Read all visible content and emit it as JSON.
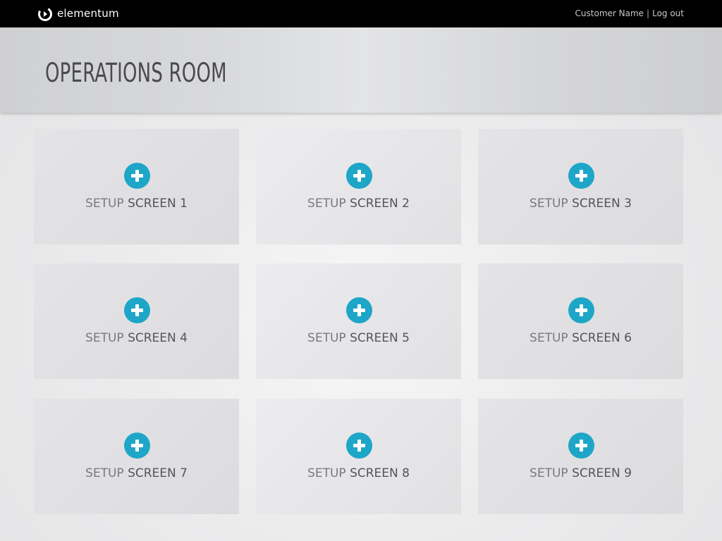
{
  "brand": {
    "name": "elementum",
    "logo_icon": "elementum-logo-mark"
  },
  "user_nav": {
    "customer_name": "Customer Name",
    "separator": "|",
    "logout_label": "Log out"
  },
  "page": {
    "title": "OPERATIONS ROOM"
  },
  "tiles": [
    {
      "prefix": "SETUP",
      "label": "SCREEN 1",
      "icon": "plus-circle-icon"
    },
    {
      "prefix": "SETUP",
      "label": "SCREEN 2",
      "icon": "plus-circle-icon"
    },
    {
      "prefix": "SETUP",
      "label": "SCREEN 3",
      "icon": "plus-circle-icon"
    },
    {
      "prefix": "SETUP",
      "label": "SCREEN 4",
      "icon": "plus-circle-icon"
    },
    {
      "prefix": "SETUP",
      "label": "SCREEN 5",
      "icon": "plus-circle-icon"
    },
    {
      "prefix": "SETUP",
      "label": "SCREEN 6",
      "icon": "plus-circle-icon"
    },
    {
      "prefix": "SETUP",
      "label": "SCREEN 7",
      "icon": "plus-circle-icon"
    },
    {
      "prefix": "SETUP",
      "label": "SCREEN 8",
      "icon": "plus-circle-icon"
    },
    {
      "prefix": "SETUP",
      "label": "SCREEN 9",
      "icon": "plus-circle-icon"
    }
  ],
  "colors": {
    "accent": "#1ea6c8",
    "topbar": "#000000",
    "title_text": "#4a4a4c"
  }
}
